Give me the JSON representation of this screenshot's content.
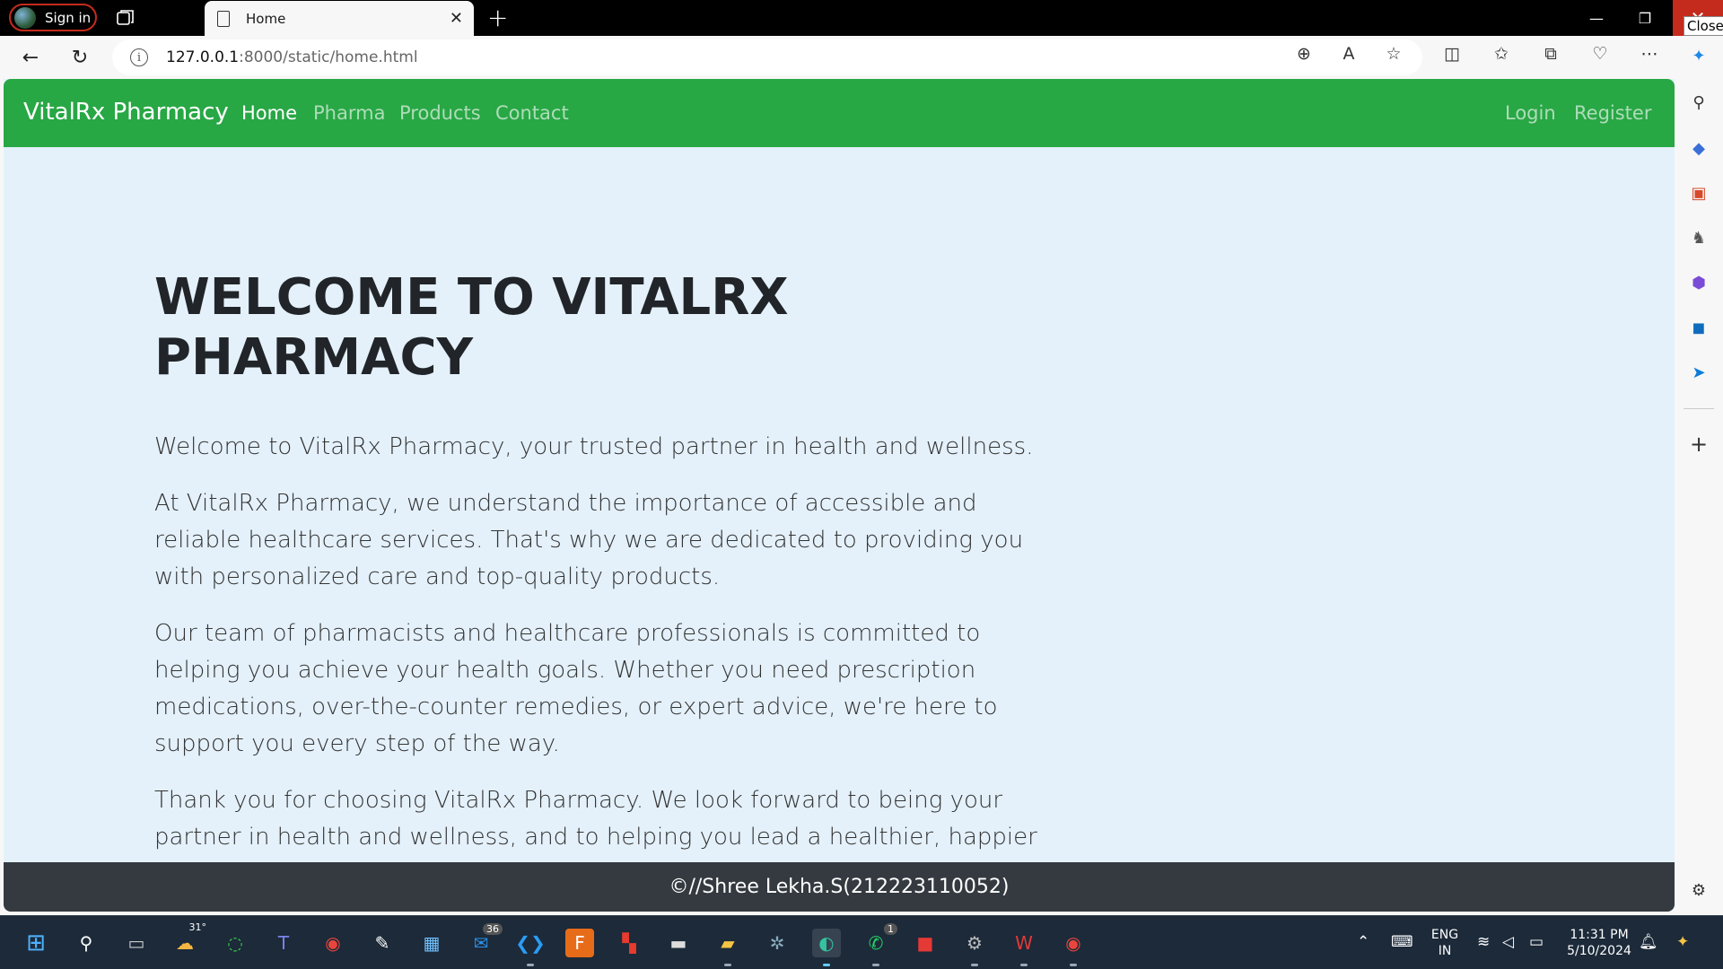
{
  "browser": {
    "profile_label": "Sign in",
    "tab_title": "Home",
    "close_tooltip": "Close",
    "url_host": "127.0.0.1",
    "url_path": ":8000/static/home.html"
  },
  "navbar": {
    "brand": "VitalRx Pharmacy",
    "links": [
      "Home",
      "Pharma",
      "Products",
      "Contact"
    ],
    "right_links": [
      "Login",
      "Register"
    ],
    "accent_color": "#28a745"
  },
  "main": {
    "title": "WELCOME TO VITALRX PHARMACY",
    "paragraphs": [
      "Welcome to VitalRx Pharmacy, your trusted partner in health and wellness.",
      "At VitalRx Pharmacy, we understand the importance of accessible and reliable healthcare services. That's why we are dedicated to providing you with personalized care and top-quality products.",
      "Our team of pharmacists and healthcare professionals is committed to helping you achieve your health goals. Whether you need prescription medications, over-the-counter remedies, or expert advice, we're here to support you every step of the way.",
      "Thank you for choosing VitalRx Pharmacy. We look forward to being your partner in health and wellness, and to helping you lead a healthier, happier life."
    ]
  },
  "footer": {
    "text": "©//Shree Lekha.S(212223110052)"
  },
  "taskbar": {
    "weather_temp": "31°",
    "mail_badge": "36",
    "whatsapp_badge": "1",
    "language_line1": "ENG",
    "language_line2": "IN",
    "time": "11:31 PM",
    "date": "5/10/2024"
  }
}
